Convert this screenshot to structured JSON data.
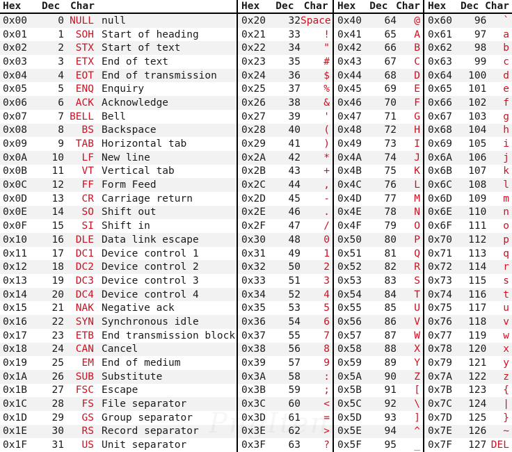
{
  "header": {
    "hex": "Hex",
    "dec": "Dec",
    "char": "Char"
  },
  "watermark": "PngItem",
  "colors": {
    "char_red": "#cc1122",
    "text": "#1a1a1a",
    "row_shade": "#f2f2f2",
    "divider": "#000000"
  },
  "columns": [
    {
      "name": "control-characters",
      "has_description": true,
      "rows": [
        {
          "hex": "0x00",
          "dec": "0",
          "char": "NULL",
          "desc": "null"
        },
        {
          "hex": "0x01",
          "dec": "1",
          "char": "SOH",
          "desc": "Start of heading"
        },
        {
          "hex": "0x02",
          "dec": "2",
          "char": "STX",
          "desc": "Start of text"
        },
        {
          "hex": "0x03",
          "dec": "3",
          "char": "ETX",
          "desc": "End of text"
        },
        {
          "hex": "0x04",
          "dec": "4",
          "char": "EOT",
          "desc": "End of transmission"
        },
        {
          "hex": "0x05",
          "dec": "5",
          "char": "ENQ",
          "desc": "Enquiry"
        },
        {
          "hex": "0x06",
          "dec": "6",
          "char": "ACK",
          "desc": "Acknowledge"
        },
        {
          "hex": "0x07",
          "dec": "7",
          "char": "BELL",
          "desc": "Bell"
        },
        {
          "hex": "0x08",
          "dec": "8",
          "char": "BS",
          "desc": "Backspace"
        },
        {
          "hex": "0x09",
          "dec": "9",
          "char": "TAB",
          "desc": "Horizontal tab"
        },
        {
          "hex": "0x0A",
          "dec": "10",
          "char": "LF",
          "desc": "New line"
        },
        {
          "hex": "0x0B",
          "dec": "11",
          "char": "VT",
          "desc": "Vertical tab"
        },
        {
          "hex": "0x0C",
          "dec": "12",
          "char": "FF",
          "desc": "Form Feed"
        },
        {
          "hex": "0x0D",
          "dec": "13",
          "char": "CR",
          "desc": "Carriage return"
        },
        {
          "hex": "0x0E",
          "dec": "14",
          "char": "SO",
          "desc": "Shift out"
        },
        {
          "hex": "0x0F",
          "dec": "15",
          "char": "SI",
          "desc": "Shift in"
        },
        {
          "hex": "0x10",
          "dec": "16",
          "char": "DLE",
          "desc": "Data link escape"
        },
        {
          "hex": "0x11",
          "dec": "17",
          "char": "DC1",
          "desc": "Device control 1"
        },
        {
          "hex": "0x12",
          "dec": "18",
          "char": "DC2",
          "desc": "Device control 2"
        },
        {
          "hex": "0x13",
          "dec": "19",
          "char": "DC3",
          "desc": "Device control 3"
        },
        {
          "hex": "0x14",
          "dec": "20",
          "char": "DC4",
          "desc": "Device control 4"
        },
        {
          "hex": "0x15",
          "dec": "21",
          "char": "NAK",
          "desc": "Negative ack"
        },
        {
          "hex": "0x16",
          "dec": "22",
          "char": "SYN",
          "desc": "Synchronous idle"
        },
        {
          "hex": "0x17",
          "dec": "23",
          "char": "ETB",
          "desc": "End transmission block"
        },
        {
          "hex": "0x18",
          "dec": "24",
          "char": "CAN",
          "desc": "Cancel"
        },
        {
          "hex": "0x19",
          "dec": "25",
          "char": "EM",
          "desc": "End of medium"
        },
        {
          "hex": "0x1A",
          "dec": "26",
          "char": "SUB",
          "desc": "Substitute"
        },
        {
          "hex": "0x1B",
          "dec": "27",
          "char": "FSC",
          "desc": "Escape"
        },
        {
          "hex": "0x1C",
          "dec": "28",
          "char": "FS",
          "desc": "File separator"
        },
        {
          "hex": "0x1D",
          "dec": "29",
          "char": "GS",
          "desc": "Group separator"
        },
        {
          "hex": "0x1E",
          "dec": "30",
          "char": "RS",
          "desc": "Record separator"
        },
        {
          "hex": "0x1F",
          "dec": "31",
          "char": "US",
          "desc": "Unit separator"
        }
      ]
    },
    {
      "name": "punctuation-and-digits",
      "has_description": false,
      "rows": [
        {
          "hex": "0x20",
          "dec": "32",
          "char": "Space"
        },
        {
          "hex": "0x21",
          "dec": "33",
          "char": "!"
        },
        {
          "hex": "0x22",
          "dec": "34",
          "char": "\""
        },
        {
          "hex": "0x23",
          "dec": "35",
          "char": "#"
        },
        {
          "hex": "0x24",
          "dec": "36",
          "char": "$"
        },
        {
          "hex": "0x25",
          "dec": "37",
          "char": "%"
        },
        {
          "hex": "0x26",
          "dec": "38",
          "char": "&"
        },
        {
          "hex": "0x27",
          "dec": "39",
          "char": "'"
        },
        {
          "hex": "0x28",
          "dec": "40",
          "char": "("
        },
        {
          "hex": "0x29",
          "dec": "41",
          "char": ")"
        },
        {
          "hex": "0x2A",
          "dec": "42",
          "char": "*"
        },
        {
          "hex": "0x2B",
          "dec": "43",
          "char": "+"
        },
        {
          "hex": "0x2C",
          "dec": "44",
          "char": ","
        },
        {
          "hex": "0x2D",
          "dec": "45",
          "char": "-"
        },
        {
          "hex": "0x2E",
          "dec": "46",
          "char": "."
        },
        {
          "hex": "0x2F",
          "dec": "47",
          "char": "/"
        },
        {
          "hex": "0x30",
          "dec": "48",
          "char": "0"
        },
        {
          "hex": "0x31",
          "dec": "49",
          "char": "1"
        },
        {
          "hex": "0x32",
          "dec": "50",
          "char": "2"
        },
        {
          "hex": "0x33",
          "dec": "51",
          "char": "3"
        },
        {
          "hex": "0x34",
          "dec": "52",
          "char": "4"
        },
        {
          "hex": "0x35",
          "dec": "53",
          "char": "5"
        },
        {
          "hex": "0x36",
          "dec": "54",
          "char": "6"
        },
        {
          "hex": "0x37",
          "dec": "55",
          "char": "7"
        },
        {
          "hex": "0x38",
          "dec": "56",
          "char": "8"
        },
        {
          "hex": "0x39",
          "dec": "57",
          "char": "9"
        },
        {
          "hex": "0x3A",
          "dec": "58",
          "char": ":"
        },
        {
          "hex": "0x3B",
          "dec": "59",
          "char": ";"
        },
        {
          "hex": "0x3C",
          "dec": "60",
          "char": "<"
        },
        {
          "hex": "0x3D",
          "dec": "61",
          "char": "="
        },
        {
          "hex": "0x3E",
          "dec": "62",
          "char": ">"
        },
        {
          "hex": "0x3F",
          "dec": "63",
          "char": "?"
        }
      ]
    },
    {
      "name": "uppercase-letters",
      "has_description": false,
      "rows": [
        {
          "hex": "0x40",
          "dec": "64",
          "char": "@"
        },
        {
          "hex": "0x41",
          "dec": "65",
          "char": "A"
        },
        {
          "hex": "0x42",
          "dec": "66",
          "char": "B"
        },
        {
          "hex": "0x43",
          "dec": "67",
          "char": "C"
        },
        {
          "hex": "0x44",
          "dec": "68",
          "char": "D"
        },
        {
          "hex": "0x45",
          "dec": "69",
          "char": "E"
        },
        {
          "hex": "0x46",
          "dec": "70",
          "char": "F"
        },
        {
          "hex": "0x47",
          "dec": "71",
          "char": "G"
        },
        {
          "hex": "0x48",
          "dec": "72",
          "char": "H"
        },
        {
          "hex": "0x49",
          "dec": "73",
          "char": "I"
        },
        {
          "hex": "0x4A",
          "dec": "74",
          "char": "J"
        },
        {
          "hex": "0x4B",
          "dec": "75",
          "char": "K"
        },
        {
          "hex": "0x4C",
          "dec": "76",
          "char": "L"
        },
        {
          "hex": "0x4D",
          "dec": "77",
          "char": "M"
        },
        {
          "hex": "0x4E",
          "dec": "78",
          "char": "N"
        },
        {
          "hex": "0x4F",
          "dec": "79",
          "char": "O"
        },
        {
          "hex": "0x50",
          "dec": "80",
          "char": "P"
        },
        {
          "hex": "0x51",
          "dec": "81",
          "char": "Q"
        },
        {
          "hex": "0x52",
          "dec": "82",
          "char": "R"
        },
        {
          "hex": "0x53",
          "dec": "83",
          "char": "S"
        },
        {
          "hex": "0x54",
          "dec": "84",
          "char": "T"
        },
        {
          "hex": "0x55",
          "dec": "85",
          "char": "U"
        },
        {
          "hex": "0x56",
          "dec": "86",
          "char": "V"
        },
        {
          "hex": "0x57",
          "dec": "87",
          "char": "W"
        },
        {
          "hex": "0x58",
          "dec": "88",
          "char": "X"
        },
        {
          "hex": "0x59",
          "dec": "89",
          "char": "Y"
        },
        {
          "hex": "0x5A",
          "dec": "90",
          "char": "Z"
        },
        {
          "hex": "0x5B",
          "dec": "91",
          "char": "["
        },
        {
          "hex": "0x5C",
          "dec": "92",
          "char": "\\"
        },
        {
          "hex": "0x5D",
          "dec": "93",
          "char": "]"
        },
        {
          "hex": "0x5E",
          "dec": "94",
          "char": "^"
        },
        {
          "hex": "0x5F",
          "dec": "95",
          "char": "_"
        }
      ]
    },
    {
      "name": "lowercase-letters",
      "has_description": false,
      "rows": [
        {
          "hex": "0x60",
          "dec": "96",
          "char": "`"
        },
        {
          "hex": "0x61",
          "dec": "97",
          "char": "a"
        },
        {
          "hex": "0x62",
          "dec": "98",
          "char": "b"
        },
        {
          "hex": "0x63",
          "dec": "99",
          "char": "c"
        },
        {
          "hex": "0x64",
          "dec": "100",
          "char": "d"
        },
        {
          "hex": "0x65",
          "dec": "101",
          "char": "e"
        },
        {
          "hex": "0x66",
          "dec": "102",
          "char": "f"
        },
        {
          "hex": "0x67",
          "dec": "103",
          "char": "g"
        },
        {
          "hex": "0x68",
          "dec": "104",
          "char": "h"
        },
        {
          "hex": "0x69",
          "dec": "105",
          "char": "i"
        },
        {
          "hex": "0x6A",
          "dec": "106",
          "char": "j"
        },
        {
          "hex": "0x6B",
          "dec": "107",
          "char": "k"
        },
        {
          "hex": "0x6C",
          "dec": "108",
          "char": "l"
        },
        {
          "hex": "0x6D",
          "dec": "109",
          "char": "m"
        },
        {
          "hex": "0x6E",
          "dec": "110",
          "char": "n"
        },
        {
          "hex": "0x6F",
          "dec": "111",
          "char": "o"
        },
        {
          "hex": "0x70",
          "dec": "112",
          "char": "p"
        },
        {
          "hex": "0x71",
          "dec": "113",
          "char": "q"
        },
        {
          "hex": "0x72",
          "dec": "114",
          "char": "r"
        },
        {
          "hex": "0x73",
          "dec": "115",
          "char": "s"
        },
        {
          "hex": "0x74",
          "dec": "116",
          "char": "t"
        },
        {
          "hex": "0x75",
          "dec": "117",
          "char": "u"
        },
        {
          "hex": "0x76",
          "dec": "118",
          "char": "v"
        },
        {
          "hex": "0x77",
          "dec": "119",
          "char": "w"
        },
        {
          "hex": "0x78",
          "dec": "120",
          "char": "x"
        },
        {
          "hex": "0x79",
          "dec": "121",
          "char": "y"
        },
        {
          "hex": "0x7A",
          "dec": "122",
          "char": "z"
        },
        {
          "hex": "0x7B",
          "dec": "123",
          "char": "{"
        },
        {
          "hex": "0x7C",
          "dec": "124",
          "char": "|"
        },
        {
          "hex": "0x7D",
          "dec": "125",
          "char": "}"
        },
        {
          "hex": "0x7E",
          "dec": "126",
          "char": "~"
        },
        {
          "hex": "0x7F",
          "dec": "127",
          "char": "DEL"
        }
      ]
    }
  ]
}
